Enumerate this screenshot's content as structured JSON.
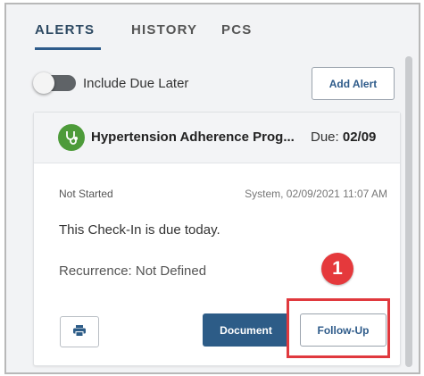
{
  "tabs": [
    {
      "label": "ALERTS",
      "active": true
    },
    {
      "label": "HISTORY",
      "active": false
    },
    {
      "label": "PCS",
      "active": false
    }
  ],
  "filters": {
    "include_due_later_label": "Include Due Later",
    "include_due_later_on": false
  },
  "toolbar": {
    "add_alert_label": "Add Alert"
  },
  "alert": {
    "icon": "stethoscope-icon",
    "title": "Hypertension Adherence Prog...",
    "due_label": "Due:",
    "due_date": "02/09",
    "status": "Not Started",
    "created": "System, 02/09/2021 11:07 AM",
    "message": "This Check-In is due today.",
    "recurrence": "Recurrence: Not Defined",
    "print_icon": "printer-icon",
    "document_label": "Document",
    "followup_label": "Follow-Up"
  },
  "callout": {
    "number": "1"
  },
  "colors": {
    "primary": "#2d5c87",
    "program_icon": "#4d9b3a",
    "callout": "#e5393c"
  }
}
